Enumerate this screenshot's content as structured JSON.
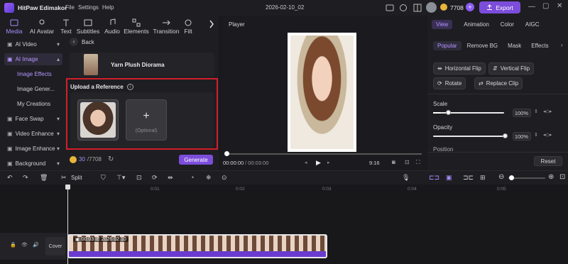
{
  "app": {
    "name": "HitPaw Edimakor",
    "menu": [
      "File",
      "Settings",
      "Help"
    ],
    "project_name": "2026-02-10_02",
    "credits": "7708",
    "export_label": "Export"
  },
  "toolbar": {
    "tabs": [
      "Media",
      "AI Avatar",
      "Text",
      "Subtitles",
      "Audio",
      "Elements",
      "Transition",
      "Filt"
    ]
  },
  "sidebar": {
    "items": [
      "AI Video",
      "AI Image",
      "Image Effects",
      "Image Gener...",
      "My Creations",
      "Face Swap",
      "Video Enhance",
      "Image Enhance",
      "Background"
    ]
  },
  "panel": {
    "back_label": "Back",
    "effect_name": "Yarn Plush Diorama",
    "upload_title": "Upload a Reference",
    "optional_label": "(Optional)",
    "credits_used": "30",
    "credits_total": "/7708",
    "generate_label": "Generate"
  },
  "player": {
    "title": "Player",
    "time_current": "00:00:00",
    "time_total": "/ 00:03:00",
    "ratio": "9:16"
  },
  "props": {
    "tabs": [
      "View",
      "Animation",
      "Color",
      "AIGC"
    ],
    "subtabs": [
      "Popular",
      "Remove BG",
      "Mask",
      "Effects"
    ],
    "buttons": [
      "Horizontal Flip",
      "Vertical Flip",
      "Rotate",
      "Replace Clip"
    ],
    "scale_label": "Scale",
    "scale_value": "100%",
    "scale_level": 0.1,
    "opacity_label": "Opacity",
    "opacity_value": "100%",
    "opacity_level": 1.0,
    "position_label": "Position",
    "reset_label": "Reset"
  },
  "timeline": {
    "split_label": "Split",
    "ticks": [
      "0:01",
      "0:02",
      "0:03",
      "0:04",
      "0:05"
    ],
    "cover_label": "Cover",
    "clip_label": "00:03 IE 2026 02 10"
  },
  "colors": {
    "accent": "#8b5cf6",
    "export": "#7c4ddb",
    "highlight_box": "#d21f2b",
    "timeline_clip": "#6a3bd0"
  }
}
